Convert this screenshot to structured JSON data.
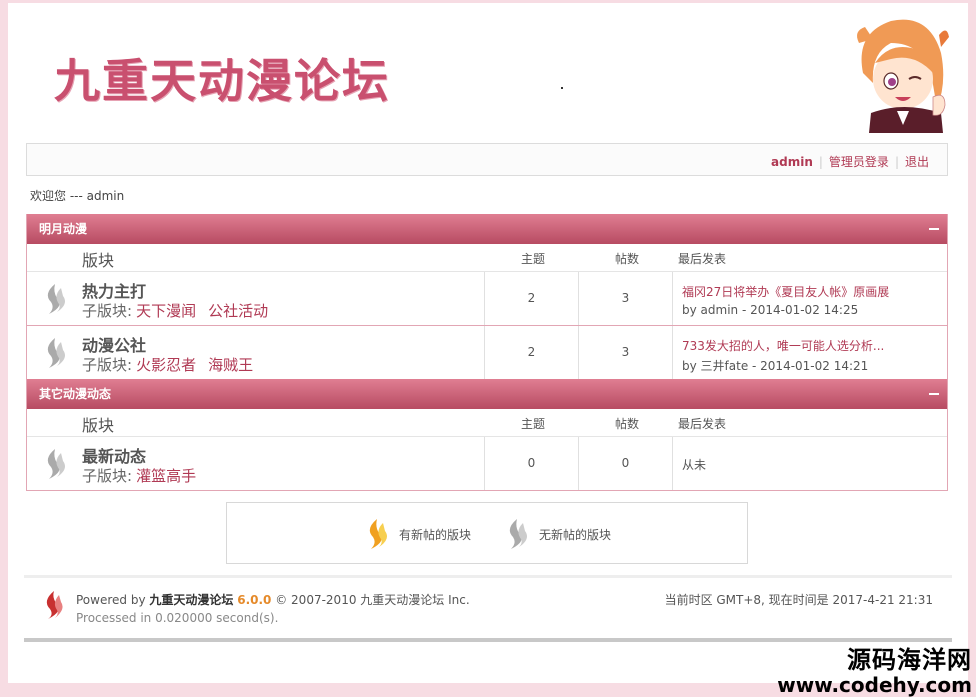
{
  "site": {
    "logo_text": "九重天动漫论坛"
  },
  "userbar": {
    "username": "admin",
    "admin_login": "管理员登录",
    "logout": "退出"
  },
  "welcome": "欢迎您 --- admin",
  "columns": {
    "board": "版块",
    "topics": "主题",
    "posts": "帖数",
    "last_post": "最后发表"
  },
  "sub_label": "子版块:",
  "categories": [
    {
      "title": "明月动漫",
      "forums": [
        {
          "name": "热力主打",
          "subs": [
            "天下漫闻",
            "公社活动"
          ],
          "topics": "2",
          "posts": "3",
          "last_title": "福冈27日将举办《夏目友人帐》原画展",
          "last_by": "by admin - 2014-01-02 14:25"
        },
        {
          "name": "动漫公社",
          "subs": [
            "火影忍者",
            "海贼王"
          ],
          "topics": "2",
          "posts": "3",
          "last_title": "733发大招的人，唯一可能人选分析...",
          "last_by": "by 三井fate - 2014-01-02 14:21"
        }
      ]
    },
    {
      "title": "其它动漫动态",
      "forums": [
        {
          "name": "最新动态",
          "subs": [
            "灌篮高手"
          ],
          "topics": "0",
          "posts": "0",
          "last_none": "从未"
        }
      ]
    }
  ],
  "legend": {
    "new": "有新帖的版块",
    "no_new": "无新帖的版块"
  },
  "footer": {
    "powered_prefix": "Powered by",
    "powered_name": "九重天动漫论坛",
    "version": "6.0.0",
    "copyright": "© 2007-2010 九重天动漫论坛 Inc.",
    "processed": "Processed in 0.020000 second(s).",
    "timezone": "当前时区 GMT+8, 现在时间是 2017-4-21 21:31"
  },
  "watermark": {
    "line1": "源码海洋网",
    "line2": "www.codehy.com"
  },
  "colors": {
    "accent": "#b03a54",
    "header_top": "#e07e92",
    "header_bottom": "#b74b62",
    "version": "#e58a2a"
  }
}
